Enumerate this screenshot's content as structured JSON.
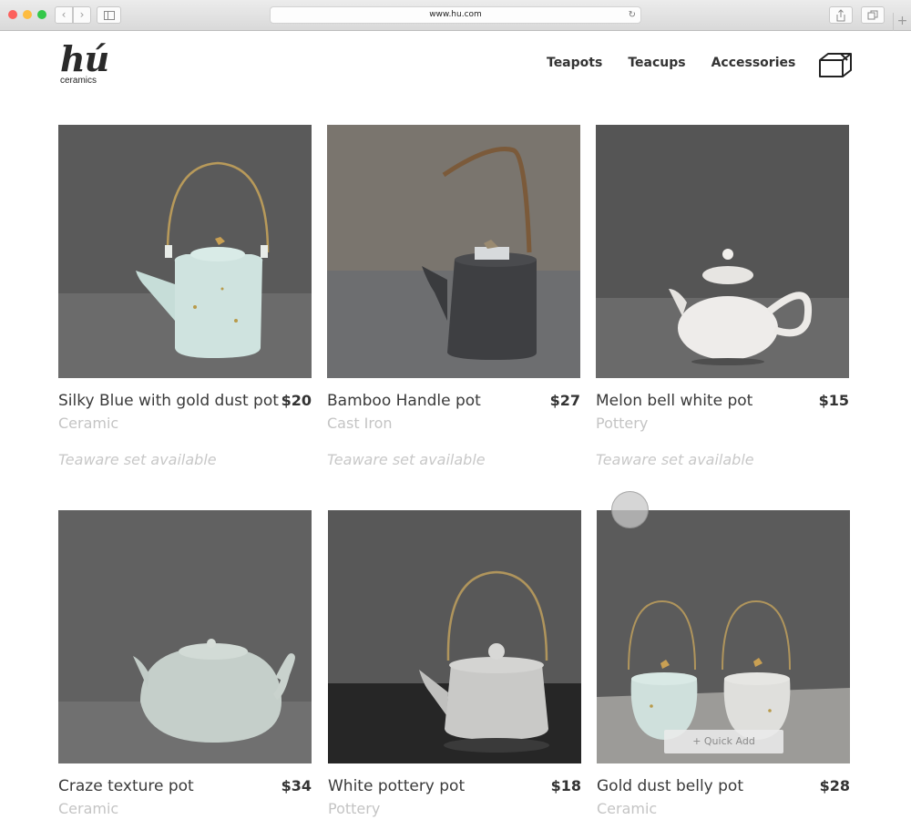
{
  "browser": {
    "url": "www.hu.com",
    "back_glyph": "‹",
    "forward_glyph": "›",
    "reload_glyph": "↻",
    "new_tab_glyph": "+"
  },
  "brand": {
    "mark": "hú",
    "sub": "ceramics"
  },
  "nav": {
    "items": [
      "Teapots",
      "Teacups",
      "Accessories"
    ],
    "cart_icon": "box-cart-icon"
  },
  "products": [
    {
      "name": "Silky Blue with gold dust pot",
      "price": "$20",
      "material": "Ceramic",
      "note": "Teaware set available"
    },
    {
      "name": "Bamboo Handle pot",
      "price": "$27",
      "material": "Cast Iron",
      "note": "Teaware set available"
    },
    {
      "name": "Melon bell white pot",
      "price": "$15",
      "material": "Pottery",
      "note": "Teaware set available"
    },
    {
      "name": "Craze texture pot",
      "price": "$34",
      "material": "Ceramic"
    },
    {
      "name": "White pottery pot",
      "price": "$18",
      "material": "Pottery"
    },
    {
      "name": "Gold dust belly pot",
      "price": "$28",
      "material": "Ceramic",
      "quick_add": "+ Quick Add"
    }
  ],
  "colors": {
    "photo_bg": "#5c5c5c",
    "accent_text": "#333333",
    "muted_text": "#c4c4c4"
  }
}
